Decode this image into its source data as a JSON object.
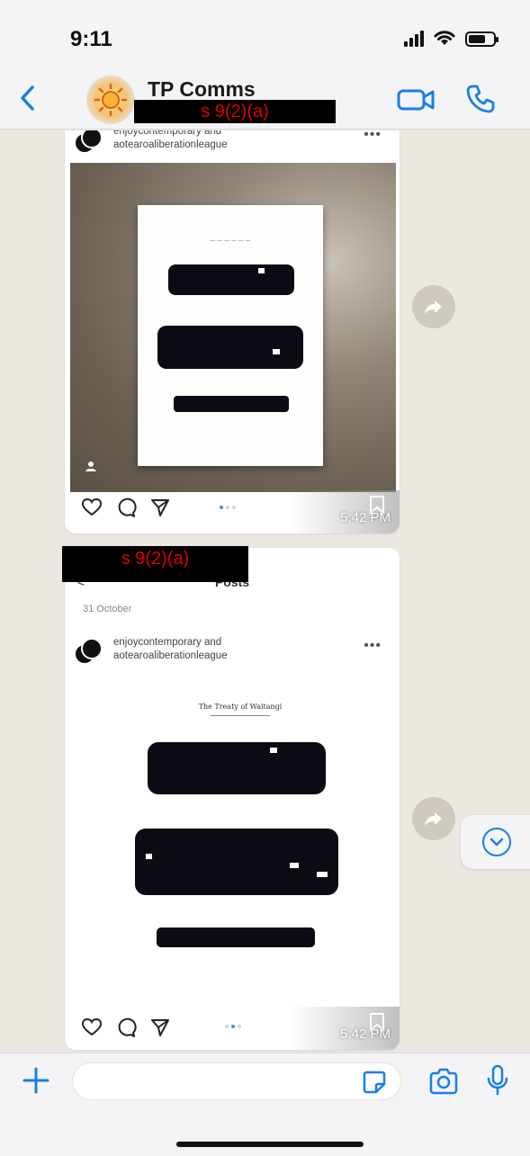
{
  "status_bar": {
    "time": "9:11"
  },
  "chat_header": {
    "name": "TP Comms",
    "redaction_label": "s 9(2)(a)"
  },
  "messages": [
    {
      "account": "enjoycontemporary and aotearoaliberationleague",
      "more": "•••",
      "time": "5:42 PM",
      "carousel": {
        "count": 3,
        "active": 1
      }
    },
    {
      "redaction_label": "s 9(2)(a)",
      "screen_title": "Posts",
      "date": "31 October",
      "account": "enjoycontemporary and aotearoaliberationleague",
      "more": "•••",
      "document_title": "The Treaty of Waitangi",
      "time": "5:42 PM",
      "carousel": {
        "count": 3,
        "active": 2
      }
    }
  ],
  "composer": {
    "value": ""
  },
  "colors": {
    "accent": "#1a7ee6",
    "redaction": "#000000",
    "redaction_text": "#e00000"
  }
}
